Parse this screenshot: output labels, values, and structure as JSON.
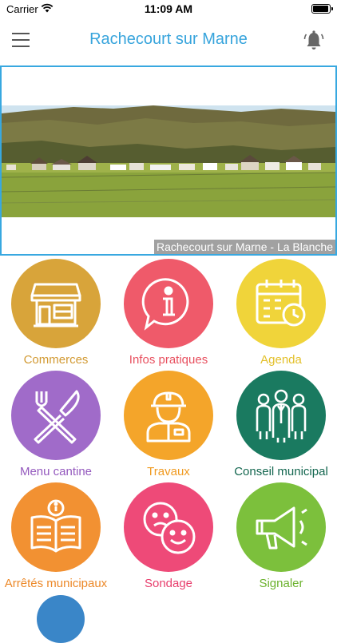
{
  "status_bar": {
    "carrier": "Carrier",
    "time": "11:09 AM"
  },
  "header": {
    "title": "Rachecourt sur Marne",
    "menu_icon": "hamburger-menu-icon",
    "notification_icon": "alarm-bell-icon"
  },
  "banner": {
    "caption": "Rachecourt sur Marne - La Blanche"
  },
  "tiles": [
    {
      "label": "Commerces",
      "color": "#d8a43a",
      "label_color": "#d29a33",
      "icon": "storefront-icon"
    },
    {
      "label": "Infos pratiques",
      "color": "#ef5a6a",
      "label_color": "#e8505f",
      "icon": "info-bubble-icon"
    },
    {
      "label": "Agenda",
      "color": "#f0d43a",
      "label_color": "#e3c02a",
      "icon": "calendar-clock-icon"
    },
    {
      "label": "Menu cantine",
      "color": "#a06bc9",
      "label_color": "#9459be",
      "icon": "fork-knife-icon"
    },
    {
      "label": "Travaux",
      "color": "#f4a52a",
      "label_color": "#f09a20",
      "icon": "construction-worker-icon"
    },
    {
      "label": "Conseil municipal",
      "color": "#1a7a60",
      "label_color": "#13664f",
      "icon": "council-group-icon"
    },
    {
      "label": "Arrêtés municipaux",
      "color": "#f29132",
      "label_color": "#ec8828",
      "icon": "open-book-info-icon"
    },
    {
      "label": "Sondage",
      "color": "#ee4a78",
      "label_color": "#e83e6d",
      "icon": "emoji-faces-icon"
    },
    {
      "label": "Signaler",
      "color": "#7cc03c",
      "label_color": "#6cb22e",
      "icon": "megaphone-icon"
    }
  ]
}
